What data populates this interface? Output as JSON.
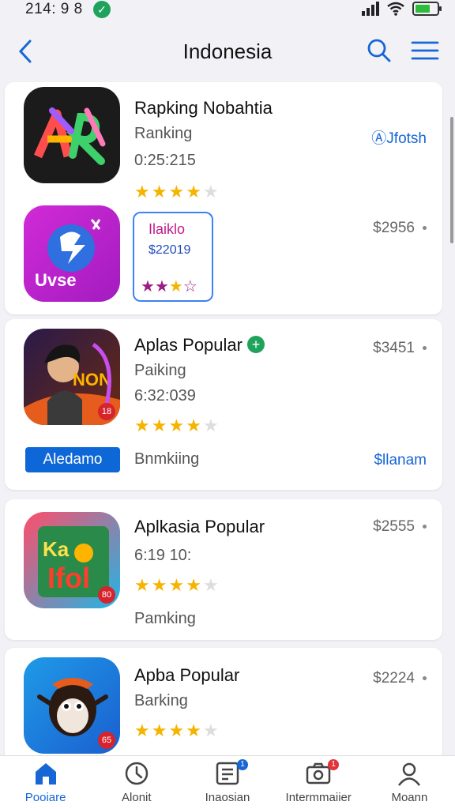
{
  "status": {
    "time": "214: 9 8",
    "notif_icon": "check-icon"
  },
  "nav": {
    "title": "Indonesia"
  },
  "apps": [
    {
      "name": "Rapking Nobahtia",
      "sub1": "Ranking",
      "sub2": "0:25:215",
      "rating": 3.5,
      "link": "© Jfotsh",
      "link_short": "Jfotsh",
      "icon": "apk-logo-icon"
    },
    {
      "price": "$2956",
      "mini_title": "Ilaiklo",
      "mini_price": "$22019",
      "mini_rating": "2.5",
      "icon_label": "Uvse",
      "icon": "uvse-app-icon"
    },
    {
      "name": "Aplas Popular",
      "sub1": "Paiking",
      "sub2": "6:32:039",
      "rating": 4,
      "price": "$3451",
      "chip": "Aledamo",
      "below": "Bnmkiing",
      "link": "$llanam",
      "icon": "game-character-icon",
      "badge": "18"
    },
    {
      "name": "Aplkasia Popular",
      "sub2": "6:19 10:",
      "rating": 3.5,
      "price": "$2555",
      "below": "Pamking",
      "icon": "kanji-game-icon",
      "badge": "80"
    },
    {
      "name": "Apba Popular",
      "sub1": "Barking",
      "rating": 3.5,
      "price": "$2224",
      "icon": "monkey-mascot-icon",
      "badge": "65"
    }
  ],
  "tabs": [
    {
      "label": "Pooiare",
      "icon": "home-icon",
      "active": true
    },
    {
      "label": "Alonit",
      "icon": "clock-icon"
    },
    {
      "label": "Inaosian",
      "icon": "list-icon",
      "badge": "1"
    },
    {
      "label": "Intermmaiier",
      "icon": "camera-icon",
      "badge": "1"
    },
    {
      "label": "Moann",
      "icon": "person-icon"
    }
  ],
  "colors": {
    "accent": "#1766d6",
    "star": "#f5b400",
    "green": "#1fa35c"
  }
}
